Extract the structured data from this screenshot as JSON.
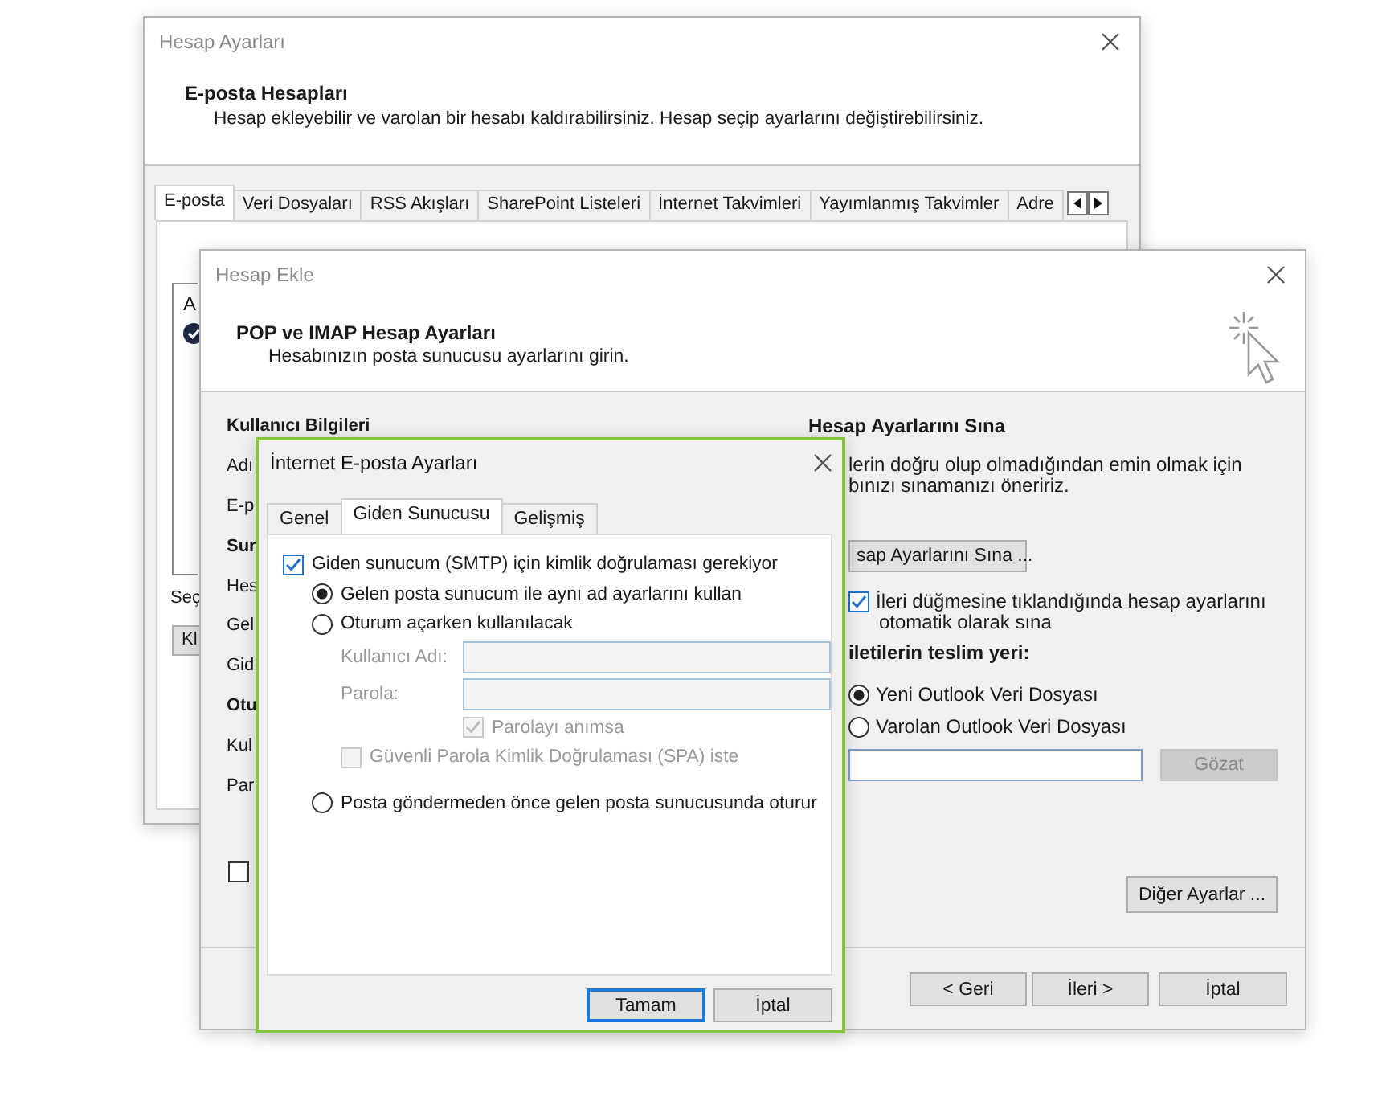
{
  "back_window": {
    "title": "Hesap Ayarları",
    "heading": "E-posta Hesapları",
    "description": "Hesap ekleyebilir ve varolan bir hesabı kaldırabilirsiniz. Hesap seçip ayarlarını değiştirebilirsiniz.",
    "tabs": [
      {
        "label": "E-posta",
        "selected": true
      },
      {
        "label": "Veri Dosyaları",
        "selected": false
      },
      {
        "label": "RSS Akışları",
        "selected": false
      },
      {
        "label": "SharePoint Listeleri",
        "selected": false
      },
      {
        "label": "İnternet Takvimleri",
        "selected": false
      },
      {
        "label": "Yayımlanmış Takvimler",
        "selected": false
      },
      {
        "label": "Adre",
        "selected": false
      }
    ],
    "list_column": "A",
    "section_label": "Seç",
    "button": "Kl"
  },
  "add_window": {
    "title": "Hesap Ekle",
    "heading": "POP ve IMAP Hesap Ayarları",
    "description": "Hesabınızın posta sunucusu ayarlarını girin.",
    "left_labels": [
      {
        "text": "Kullanıcı Bilgileri",
        "kind": "heading"
      },
      {
        "text": "Adı",
        "kind": "label"
      },
      {
        "text": "E-p",
        "kind": "label"
      },
      {
        "text": "Sur",
        "kind": "heading"
      },
      {
        "text": "Hes",
        "kind": "label"
      },
      {
        "text": "Gel",
        "kind": "label"
      },
      {
        "text": "Gid",
        "kind": "label"
      },
      {
        "text": "Otu",
        "kind": "heading"
      },
      {
        "text": "Kul",
        "kind": "label"
      },
      {
        "text": "Par",
        "kind": "label"
      }
    ],
    "bottom_checkbox": {
      "checked": false
    },
    "test_heading": "Hesap Ayarlarını Sına",
    "test_text": [
      "lerin doğru olup olmadığından emin olmak için",
      "bınızı sınamanızı öneririz."
    ],
    "test_button": "sap Ayarlarını Sına ...",
    "auto_test": {
      "lines": [
        "İleri düğmesine tıklandığında hesap ayarlarını",
        "otomatik olarak sına"
      ],
      "checked": true
    },
    "delivery_heading": "iletilerin teslim yeri:",
    "delivery_options": [
      {
        "label": "Yeni Outlook Veri Dosyası",
        "selected": true
      },
      {
        "label": "Varolan Outlook Veri Dosyası",
        "selected": false
      }
    ],
    "browse_button": {
      "label": "Gözat",
      "disabled": true
    },
    "more_button": "Diğer Ayarlar ...",
    "footer_buttons": [
      {
        "label": "< Geri"
      },
      {
        "label": "İleri >"
      },
      {
        "label": "İptal"
      }
    ]
  },
  "dialog": {
    "title": "İnternet E-posta Ayarları",
    "tabs": [
      {
        "label": "Genel",
        "selected": false
      },
      {
        "label": "Giden Sunucusu",
        "selected": true
      },
      {
        "label": "Gelişmiş",
        "selected": false
      }
    ],
    "options": [
      {
        "kind": "checkbox",
        "label": "Giden sunucum (SMTP) için kimlik doğrulaması gerekiyor",
        "checked": true,
        "disabled": false
      },
      {
        "kind": "radio",
        "label": "Gelen posta sunucum ile aynı ad ayarlarını kullan",
        "selected": true
      },
      {
        "kind": "radio",
        "label": "Oturum açarken kullanılacak",
        "selected": false
      },
      {
        "kind": "field",
        "label": "Kullanıcı Adı:",
        "disabled": true
      },
      {
        "kind": "field",
        "label": "Parola:",
        "disabled": true
      },
      {
        "kind": "field-check",
        "label": "Parolayı anımsa",
        "checked": true,
        "disabled": true
      },
      {
        "kind": "sub-checkbox",
        "label": "Güvenli Parola Kimlik Doğrulaması (SPA) iste",
        "checked": false,
        "disabled": true
      },
      {
        "kind": "radio",
        "label": "Posta göndermeden önce gelen posta sunucusunda oturur",
        "selected": false
      }
    ],
    "buttons": [
      {
        "label": "Tamam",
        "focused": true
      },
      {
        "label": "İptal",
        "focused": false
      }
    ]
  }
}
